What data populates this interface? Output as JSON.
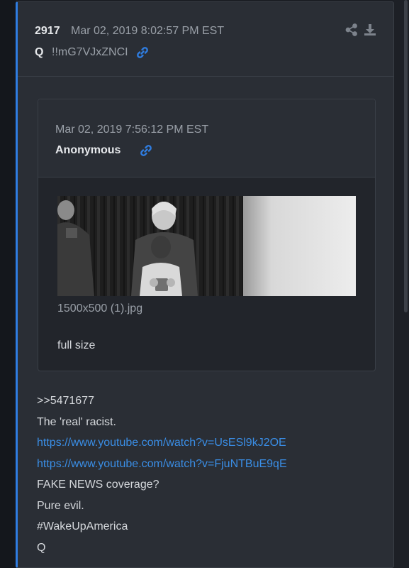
{
  "post": {
    "number": "2917",
    "date": "Mar 02, 2019 8:02:57 PM EST",
    "author": "Q",
    "tripcode": "!!mG7VJxZNCI",
    "icons": {
      "link": "link-icon",
      "share": "share-icon",
      "download": "download-icon"
    },
    "accent_color": "#2f7de1"
  },
  "quoted": {
    "date": "Mar 02, 2019 7:56:12 PM EST",
    "author": "Anonymous",
    "image_name": "1500x500 (1).jpg",
    "full_size_label": "full size"
  },
  "body": {
    "reply_ref": ">>5471677",
    "line1": "The 'real' racist.",
    "link1": "https://www.youtube.com/watch?v=UsESl9kJ2OE",
    "link2": "https://www.youtube.com/watch?v=FjuNTBuE9qE",
    "line2": "FAKE NEWS coverage?",
    "line3": "Pure evil.",
    "line4": "#WakeUpAmerica",
    "signature": "Q",
    "link_color": "#3a8ee6"
  }
}
